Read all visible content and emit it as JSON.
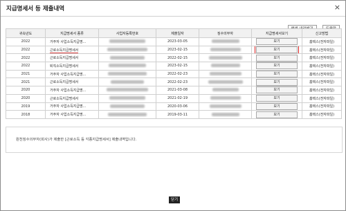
{
  "title": "지급명세서 등 제출내역",
  "close_glyph": "×",
  "toolbar": {
    "print_label": "엑셀 내려받기",
    "help_label": "도움말"
  },
  "table": {
    "headers": [
      "귀속년도",
      "지급명세서 종류",
      "사업자등록번호",
      "제출일자",
      "징수의무자",
      "지급명세서보기",
      "신고방법"
    ],
    "rows": [
      {
        "year": "2022",
        "type": "거주자 사업소득지급명...",
        "date": "2023-03-05",
        "view": "보기",
        "method": "홈택스(전자파일)"
      },
      {
        "year": "2022",
        "type": "근로소득지급명세서",
        "date": "2023-02-15",
        "view": "보기",
        "method": "홈택스(전자파일)"
      },
      {
        "year": "2022",
        "type": "근로소득지급명세서",
        "date": "2022-02-15",
        "view": "보기",
        "method": "홈택스(전자파일)"
      },
      {
        "year": "2022",
        "type": "퇴직소득지급명세서",
        "date": "2023-02-15",
        "view": "보기",
        "method": "홈택스(전자파일)"
      },
      {
        "year": "2021",
        "type": "거주자 사업소득지급명...",
        "date": "2022-02-23",
        "view": "보기",
        "method": "홈택스(전자파일)"
      },
      {
        "year": "2021",
        "type": "근로소득지급명세서",
        "date": "2022-02-23",
        "view": "보기",
        "method": "홈택스(전자파일)"
      },
      {
        "year": "2020",
        "type": "거주자 사업소득지급명...",
        "date": "2021-03-08",
        "view": "보기",
        "method": "홈택스(전자파일)"
      },
      {
        "year": "2020",
        "type": "근로소득지급명세서",
        "date": "2021-02-19",
        "view": "보기",
        "method": "홈택스(전자파일)"
      },
      {
        "year": "2019",
        "type": "거주자 사업소득지급명...",
        "date": "2020-03-06",
        "view": "보기",
        "method": "홈택스(전자파일)"
      },
      {
        "year": "2018",
        "type": "거주자 사업소득지급명...",
        "date": "2019-03-11",
        "view": "보기",
        "method": "홈택스(전자파일)"
      }
    ]
  },
  "note": "원천징수의무자(회사)가 제출한 [근로소득 등 각종지급명세서] 제출내역입니다.",
  "close_button": "닫기",
  "colors": {
    "highlight": "#e02020",
    "close_button_bg": "#222222"
  }
}
